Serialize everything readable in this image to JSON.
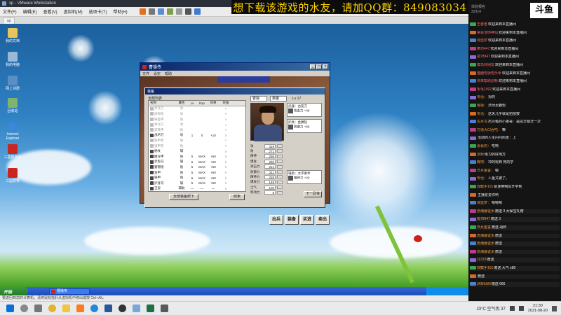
{
  "host": {
    "vm_title": "xp - VMware Workstation",
    "vm_menu": [
      "文件(F)",
      "编辑(E)",
      "查看(V)",
      "虚拟机(M)",
      "选项卡(T)",
      "帮助(H)"
    ],
    "vm_tab": "xp",
    "promo_banner": "想下载该游戏的水友，请加QQ群：849083034",
    "status_text": "要返回到您的计算机，请将鼠标指针从虚拟机中移出或按 Ctrl+Alt。",
    "tray_weather": "23°C 空气优 37",
    "clock_time": "21:30",
    "clock_date": "2021-08-20"
  },
  "guest": {
    "desktop_icons": [
      "我的文档",
      "我的电脑",
      "网上邻居",
      "回收站",
      "Internet Explorer",
      "三国群英传",
      "三国群英"
    ],
    "xp_start": "开始",
    "xp_task": "曹操传",
    "xp_tray": ""
  },
  "game": {
    "window_title": "曹操传",
    "menu": [
      "文件",
      "设定",
      "帮助"
    ],
    "dialog_title": "装备",
    "list_label": "全部列表",
    "columns": [
      "名称",
      "属性",
      "Lv",
      "Exp",
      "效果",
      "装备"
    ],
    "items": [
      {
        "name": "步兵刀",
        "attr": "攻",
        "lv": "",
        "exp": "",
        "eff": "",
        "eq": "×",
        "dim": true
      },
      {
        "name": "白银枪",
        "attr": "攻",
        "lv": "",
        "exp": "",
        "eff": "",
        "eq": "×",
        "dim": true
      },
      {
        "name": "铁盔甲",
        "attr": "防",
        "lv": "",
        "exp": "",
        "eff": "",
        "eq": "×",
        "dim": true
      },
      {
        "name": "青龙刀",
        "attr": "攻",
        "lv": "",
        "exp": "",
        "eff": "",
        "eq": "×",
        "dim": true
      },
      {
        "name": "黑铁甲",
        "attr": "防",
        "lv": "",
        "exp": "",
        "eff": "",
        "eq": "×",
        "dim": true
      },
      {
        "name": "战术刃",
        "attr": "攻",
        "lv": "1",
        "exp": "0",
        "eff": "+10",
        "eq": "○",
        "dim": false
      },
      {
        "name": "铁甲冑",
        "attr": "防",
        "lv": "",
        "exp": "",
        "eff": "",
        "eq": "×",
        "dim": true
      },
      {
        "name": "锁甲衣",
        "attr": "防",
        "lv": "",
        "exp": "",
        "eff": "",
        "eq": "×",
        "dim": true
      },
      {
        "name": "秘杖",
        "attr": "辅",
        "lv": "",
        "exp": "",
        "eff": "",
        "eq": "○",
        "dim": false
      },
      {
        "name": "鳞龙甲",
        "attr": "防",
        "lv": "5",
        "exp": "MAX",
        "eff": "+50",
        "eq": "○",
        "dim": false
      },
      {
        "name": "赤兔马",
        "attr": "辅",
        "lv": "5",
        "exp": "MAX",
        "eff": "+50",
        "eq": "○",
        "dim": false
      },
      {
        "name": "蜀锦袍",
        "attr": "防",
        "lv": "5",
        "exp": "MAX",
        "eff": "+50",
        "eq": "○",
        "dim": false
      },
      {
        "name": "金甲",
        "attr": "防",
        "lv": "5",
        "exp": "MAX",
        "eff": "+50",
        "eq": "○",
        "dim": false
      },
      {
        "name": "银甲",
        "attr": "防",
        "lv": "5",
        "exp": "MAX",
        "eff": "+50",
        "eq": "○",
        "dim": false
      },
      {
        "name": "护身符",
        "attr": "辅",
        "lv": "5",
        "exp": "MAX",
        "eff": "+50",
        "eq": "○",
        "dim": false
      },
      {
        "name": "玉玺",
        "attr": "辅助",
        "lv": "—",
        "exp": "—",
        "eff": "—",
        "eq": "○",
        "dim": false
      }
    ],
    "btn_unequip_all": "全部装备卸下",
    "btn_close_list": "结束",
    "char_select": "曹操",
    "class_select": "英雄",
    "level_label": "Lv 17",
    "slot_weapon_title": "武器：古锭刀",
    "slot_weapon_sub": "攻击力 +40",
    "slot_armor_title": "护具：金鳞铠",
    "slot_armor_sub": "防御力 +60",
    "slot_aux_title": "辅助：太平要术",
    "slot_aux_sub": "精神力 +20",
    "stats": [
      {
        "label": "攻",
        "value": "319"
      },
      {
        "label": "防",
        "value": "271"
      },
      {
        "label": "精神",
        "value": "230"
      },
      {
        "label": "爆发",
        "value": "250"
      },
      {
        "label": "攻击力",
        "value": "214"
      },
      {
        "label": "防御力",
        "value": "211"
      },
      {
        "label": "精神力",
        "value": "228"
      },
      {
        "label": "爆发力",
        "value": "148"
      },
      {
        "label": "士气",
        "value": "100"
      },
      {
        "label": "移动力",
        "value": "6"
      }
    ],
    "btn_next": "下一武将",
    "big_buttons": [
      "出兵",
      "装备",
      "买进",
      "卖出"
    ]
  },
  "chat": {
    "header_line1": "体验报名",
    "header_line2": "32314",
    "logo": "斗鱼",
    "lines": [
      {
        "user": "王者者",
        "text": "欢迎来到本直播间"
      },
      {
        "user": "常会池你神仙",
        "text": "欢迎来到本直播间"
      },
      {
        "user": "城堡梦",
        "text": "欢迎来到本直播间"
      },
      {
        "user": "摩坊447",
        "text": "欢迎来到本直播间"
      },
      {
        "user": "孤78947",
        "text": "欢迎来到本直播间"
      },
      {
        "user": "摸鸟好朋友",
        "text": "欢迎来到本直播间"
      },
      {
        "user": "猫面吃饭吃乐米",
        "text": "欢迎来到本直播间"
      },
      {
        "user": "快来帮助创新",
        "text": "欢迎来到本直播间"
      },
      {
        "user": "毛毛1992",
        "text": "欢迎来到本直播间"
      },
      {
        "user": "专治：",
        "text": "对的"
      },
      {
        "user": "曹操：",
        "text": "法师太魅怡"
      },
      {
        "user": "专治：",
        "text": "这关几乎就是拍拍按"
      },
      {
        "user": "古月鸟",
        "text": "杰贝龟的小弟哥：是段方窗法一次"
      },
      {
        "user": "万道大口吞吃：",
        "text": "嘛"
      },
      {
        "user": "",
        "text": "活动的人生问问的走：上"
      },
      {
        "user": "会看的：",
        "text": "吃啊"
      },
      {
        "user": "凉粉",
        "text": "练习的好地方"
      },
      {
        "user": "晚吧：",
        "text": "冲的玩到 死的学"
      },
      {
        "user": "日月金誓：",
        "text": "嗯"
      },
      {
        "user": "专治：",
        "text": "人鱼又被了。"
      },
      {
        "user": "双截手101",
        "text": "别连带哦车升学到"
      },
      {
        "user": "",
        "text": "主播爱爱你哟"
      },
      {
        "user": "城堡梦：",
        "text": "嗯嗯嗯"
      },
      {
        "user": "赤潮暴证水",
        "text": "赠送 3 大保宝礼赠"
      },
      {
        "user": "孤78947",
        "text": "赠送 3"
      },
      {
        "user": "日月金誓",
        "text": "赠送 战帅"
      },
      {
        "user": "赤潮暴证水",
        "text": "赠送"
      },
      {
        "user": "赤潮暴证水",
        "text": "赠送"
      },
      {
        "user": "赤潮暴证水",
        "text": "赠送"
      },
      {
        "user": "11373",
        "text": "赠送"
      },
      {
        "user": "双截手101",
        "text": "赠送 大气 x88"
      },
      {
        "user": "",
        "text": "赠送"
      },
      {
        "user": "JANKAN",
        "text": "赠送 666"
      }
    ]
  }
}
